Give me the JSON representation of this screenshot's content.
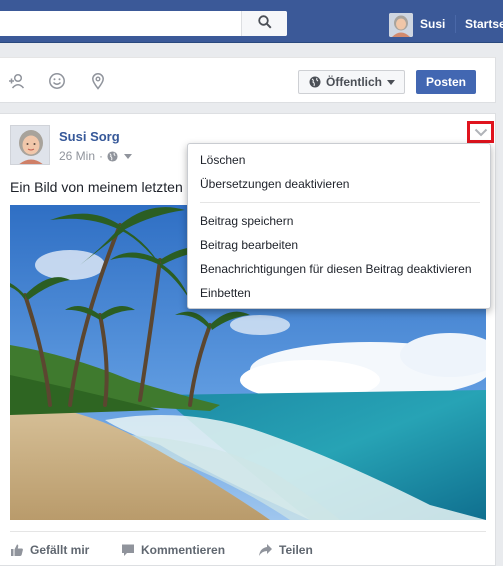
{
  "topbar": {
    "user_name": "Susi",
    "home_label": "Startse",
    "search_icon": "search-icon"
  },
  "composer": {
    "icons": [
      "tag-friends-icon",
      "feeling-smiley-icon",
      "location-pin-icon"
    ],
    "audience_label": "Öffentlich",
    "post_label": "Posten"
  },
  "post": {
    "author": "Susi Sorg",
    "time": "26 Min",
    "text": "Ein Bild von meinem letzten U",
    "actions": {
      "like": "Gefällt mir",
      "comment": "Kommentieren",
      "share": "Teilen"
    }
  },
  "menu": {
    "items": [
      "Löschen",
      "Übersetzungen deaktivieren",
      "Beitrag speichern",
      "Beitrag bearbeiten",
      "Benachrichtigungen für diesen Beitrag deaktivieren",
      "Einbetten"
    ]
  },
  "colors": {
    "brand_blue": "#3b5998",
    "post_button": "#4267b2",
    "highlight": "#e0141e"
  }
}
